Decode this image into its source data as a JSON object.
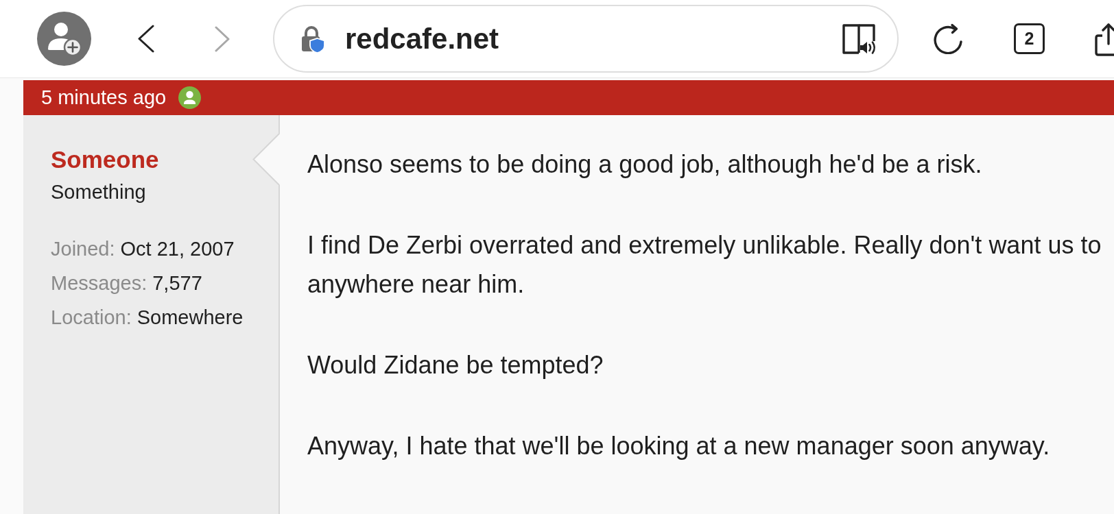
{
  "browser": {
    "nav_buttons": [
      {
        "kind": "back",
        "disabled": false
      },
      {
        "kind": "forward",
        "disabled": true
      }
    ],
    "url": "redcafe.net",
    "tab_count": "2"
  },
  "post": {
    "time": "5 minutes ago",
    "author_online": true,
    "author": {
      "name": "Someone",
      "title": "Something",
      "stats": [
        {
          "label": "Joined:",
          "value": "Oct 21, 2007"
        },
        {
          "label": "Messages:",
          "value": "7,577"
        },
        {
          "label": "Location:",
          "value": "Somewhere"
        }
      ]
    },
    "paragraphs": [
      {
        "lines": [
          "Alonso seems to be doing a good job, although he'd be a risk."
        ]
      },
      {
        "lines": [
          "I find De Zerbi overrated and extremely unlikable. Really don't want us to",
          "anywhere near him."
        ]
      },
      {
        "lines": [
          "Would Zidane be tempted?"
        ]
      },
      {
        "lines": [
          "Anyway, I hate that we'll be looking at a new manager soon anyway."
        ]
      }
    ]
  }
}
